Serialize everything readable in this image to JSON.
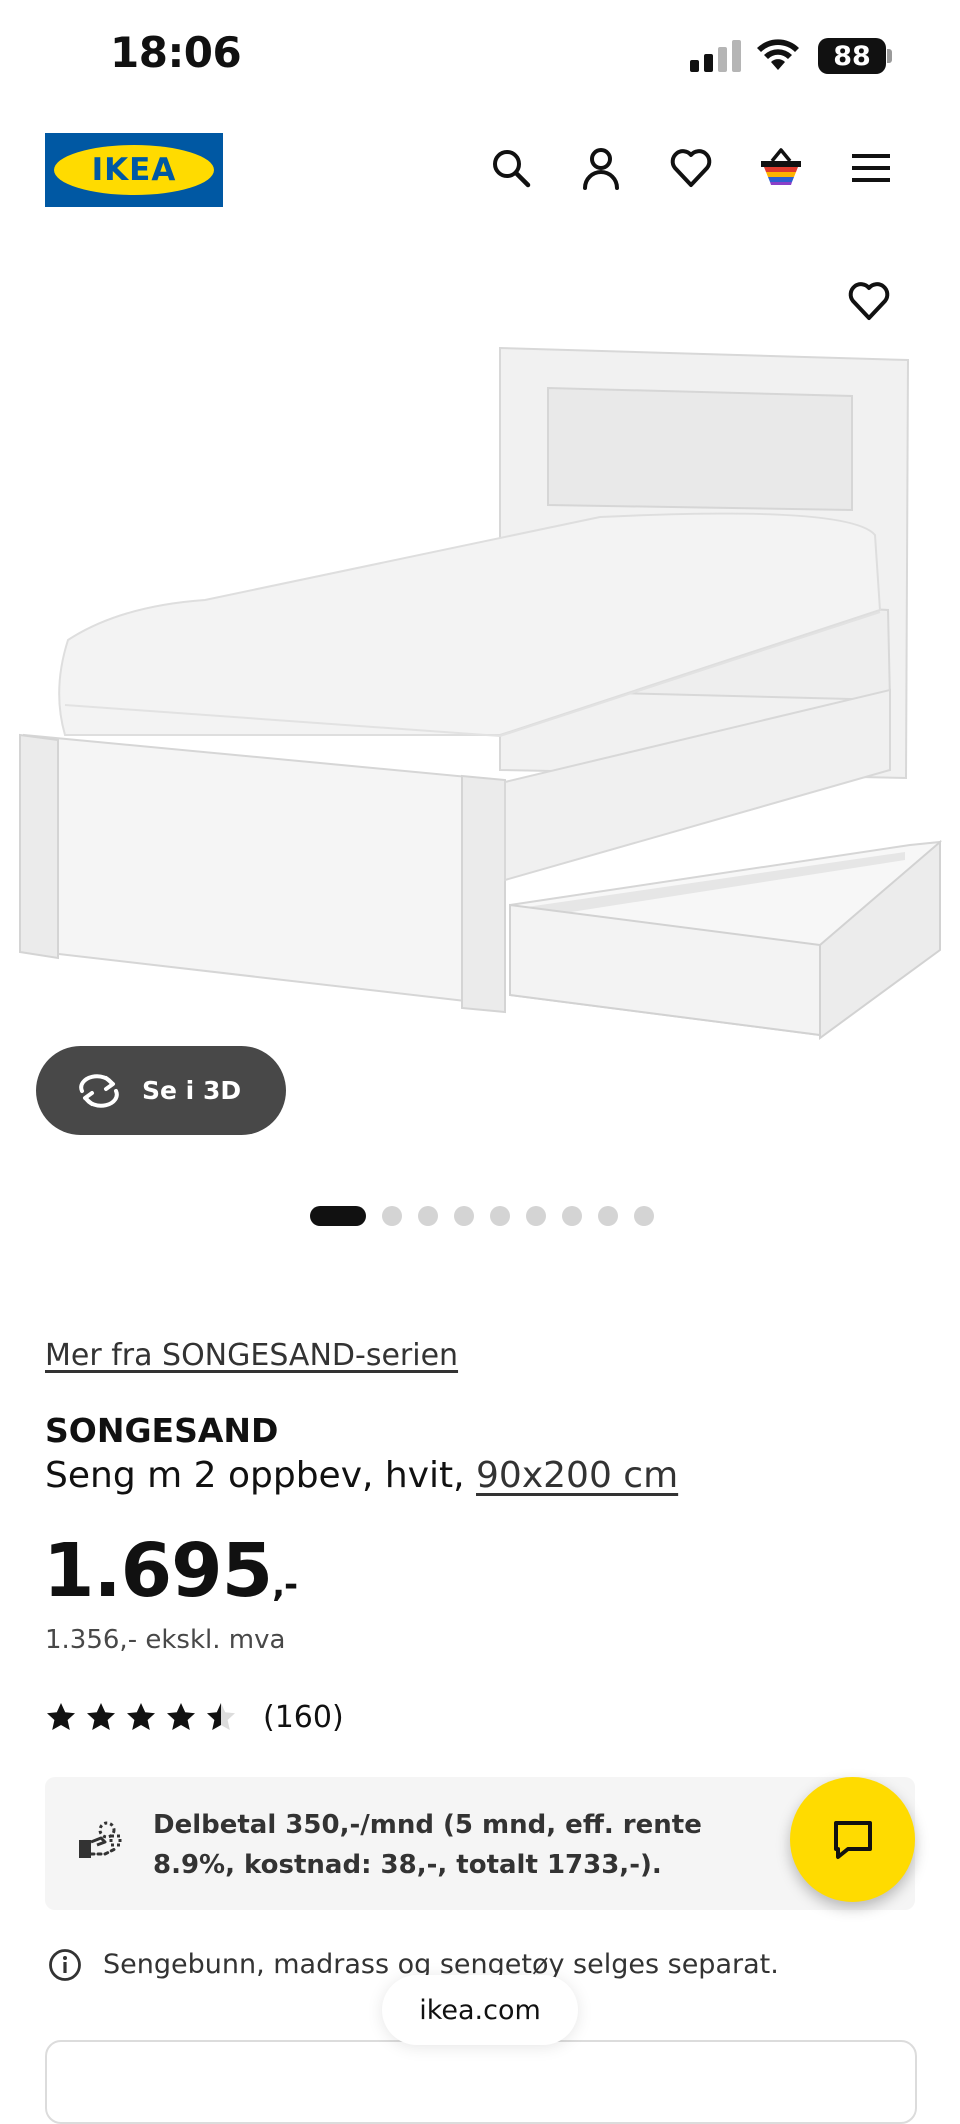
{
  "status_bar": {
    "time": "18:06",
    "battery": "88"
  },
  "header": {
    "logo_text": "IKEA",
    "icons": [
      "search-icon",
      "account-icon",
      "wishlist-icon",
      "cart-icon",
      "menu-icon"
    ]
  },
  "gallery": {
    "see_3d_label": "Se i 3D",
    "dot_count": 9,
    "active_dot": 1
  },
  "product": {
    "series_link": "Mer fra SONGESAND-serien",
    "name": "SONGESAND",
    "description": "Seng m 2 oppbev, hvit, ",
    "size_link": "90x200 cm",
    "price": "1.695",
    "price_suffix": ",-",
    "price_ex_vat": "1.356,- ekskl. mva",
    "rating": 4.5,
    "review_count": "(160)"
  },
  "finance": {
    "text": "Delbetal 350,-/mnd (5 mnd, eff. rente 8.9%, kostnad: 38,-, totalt 1733,-)."
  },
  "notice": {
    "text": "Sengebunn, madrass og sengetøy selges separat."
  },
  "browser": {
    "url": "ikea.com"
  },
  "colors": {
    "brand_blue": "#0058a3",
    "brand_yellow": "#ffdb00",
    "pill_dark": "#484848"
  }
}
